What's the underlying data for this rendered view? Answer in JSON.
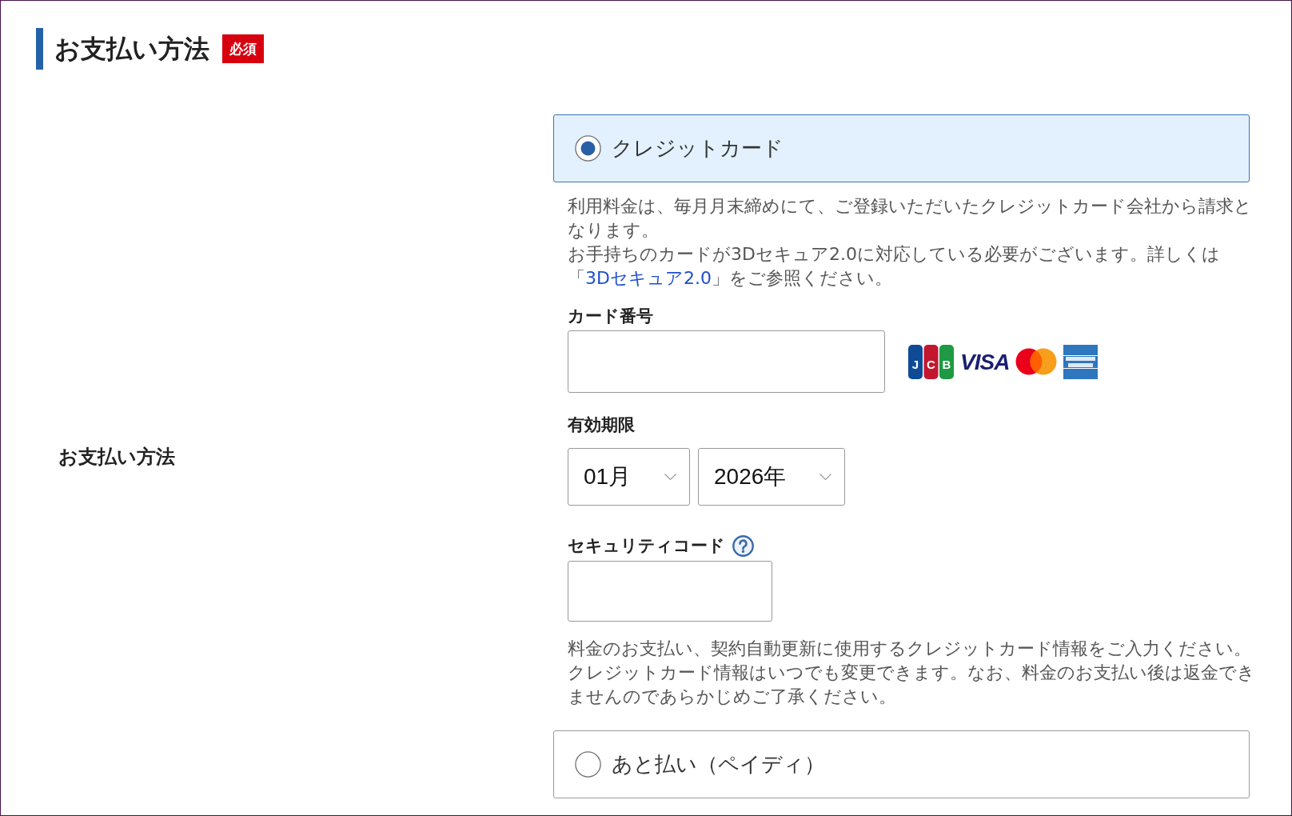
{
  "section": {
    "title": "お支払い方法",
    "badge": "必須"
  },
  "row_label": "お支払い方法",
  "payment_options": [
    {
      "label": "クレジットカード",
      "selected": true,
      "details": {
        "notice": [
          {
            "kind": "text",
            "text": "利用料金は、毎月月末締めにて、ご登録いただいたクレジットカード会社から請求となります。"
          },
          {
            "kind": "link_text",
            "before": "お手持ちのカードが3Dセキュア2.0に対応している必要がございます。詳しくは「",
            "link": "3Dセキュア2.0",
            "after": "」をご参照ください。"
          }
        ],
        "card_number": {
          "label": "カード番号",
          "brands": [
            {
              "kind": "jcb",
              "text": "JCB"
            },
            {
              "kind": "visa",
              "text": "VISA"
            },
            {
              "kind": "mastercard"
            },
            {
              "kind": "amex"
            }
          ]
        },
        "expiry": {
          "label": "有効期限",
          "month": "01月",
          "year": "2026年"
        },
        "security_code": {
          "label": "セキュリティコード"
        },
        "note": "料金のお支払い、契約自動更新に使用するクレジットカード情報をご入力ください。クレジットカード情報はいつでも変更できます。なお、料金のお支払い後は返金できませんのであらかじめご了承ください。"
      }
    },
    {
      "label": "あと払い（ペイディ）",
      "selected": false
    }
  ]
}
